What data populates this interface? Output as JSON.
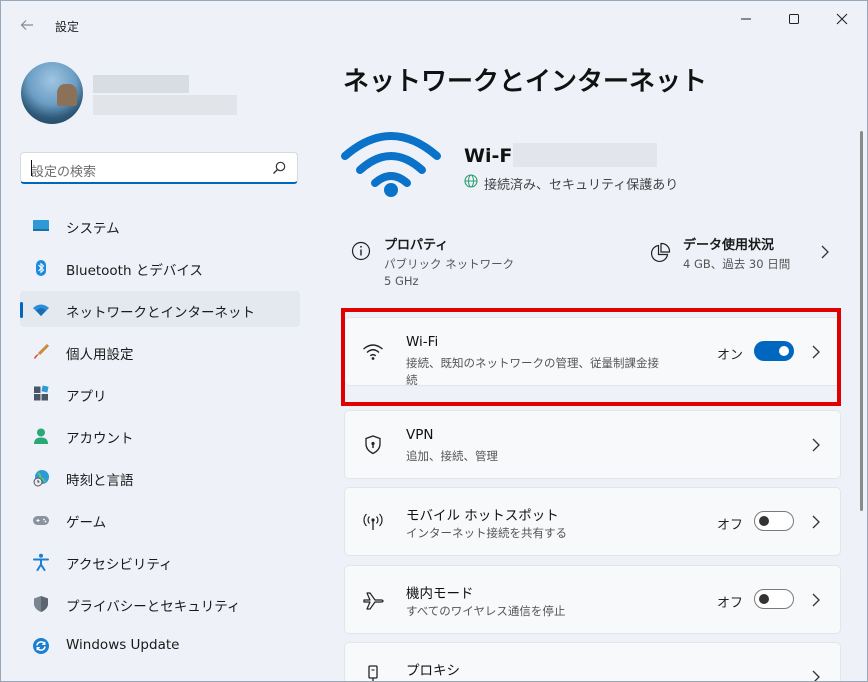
{
  "window": {
    "title": "設定"
  },
  "sidebar": {
    "search_placeholder": "設定の検索",
    "items": [
      {
        "label": "システム",
        "icon": "monitor-icon"
      },
      {
        "label": "Bluetooth とデバイス",
        "icon": "bluetooth-icon"
      },
      {
        "label": "ネットワークとインターネット",
        "icon": "wifi-diamond-icon",
        "active": true
      },
      {
        "label": "個人用設定",
        "icon": "brush-icon"
      },
      {
        "label": "アプリ",
        "icon": "apps-icon"
      },
      {
        "label": "アカウント",
        "icon": "person-icon"
      },
      {
        "label": "時刻と言語",
        "icon": "globe-clock-icon"
      },
      {
        "label": "ゲーム",
        "icon": "gamepad-icon"
      },
      {
        "label": "アクセシビリティ",
        "icon": "accessibility-icon"
      },
      {
        "label": "プライバシーとセキュリティ",
        "icon": "shield-icon"
      },
      {
        "label": "Windows Update",
        "icon": "update-icon"
      }
    ]
  },
  "main": {
    "title": "ネットワークとインターネット",
    "hero": {
      "name": "Wi-Fi",
      "status": "接続済み、セキュリティ保護あり"
    },
    "properties": {
      "title": "プロパティ",
      "line1": "パブリック ネットワーク",
      "line2": "5 GHz"
    },
    "data_usage": {
      "title": "データ使用状況",
      "detail": "4 GB、過去 30 日間"
    },
    "cards": [
      {
        "title": "Wi-Fi",
        "subtitle": "接続、既知のネットワークの管理、従量制課金接続",
        "state": "オン",
        "toggle_on": true,
        "icon": "wifi-icon"
      },
      {
        "title": "VPN",
        "subtitle": "追加、接続、管理",
        "icon": "vpn-shield-icon"
      },
      {
        "title": "モバイル ホットスポット",
        "subtitle": "インターネット接続を共有する",
        "state": "オフ",
        "toggle_on": false,
        "icon": "hotspot-icon"
      },
      {
        "title": "機内モード",
        "subtitle": "すべてのワイヤレス通信を停止",
        "state": "オフ",
        "toggle_on": false,
        "icon": "airplane-icon"
      },
      {
        "title": "プロキシ",
        "icon": "proxy-icon"
      }
    ]
  },
  "colors": {
    "accent": "#0067c0",
    "highlight": "#e00000"
  }
}
